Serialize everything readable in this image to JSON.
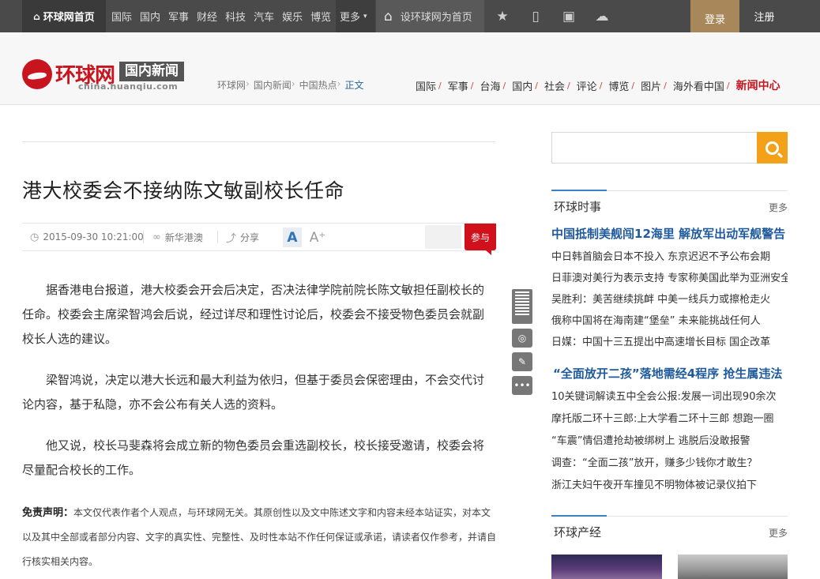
{
  "topbar": {
    "home": "环球网首页",
    "nav": [
      "国际",
      "国内",
      "军事",
      "财经",
      "科技",
      "汽车",
      "娱乐",
      "博览"
    ],
    "more": "更多",
    "set_home": "设环球网为首页",
    "login": "登录",
    "register": "注册"
  },
  "header": {
    "brand": "环球网",
    "channel": "国内新闻",
    "domain": "china.huanqiu.com",
    "breadcrumb": [
      "环球网",
      "国内新闻",
      "中国热点",
      "正文"
    ],
    "channel_nav": [
      "国际",
      "军事",
      "台海",
      "国内",
      "社会",
      "评论",
      "博览",
      "图片",
      "海外看中国"
    ],
    "channel_nav_highlight": "新闻中心"
  },
  "article": {
    "title": "港大校委会不接纳陈文敏副校长任命",
    "datetime": "2015-09-30 10:21:00",
    "source": "新华港澳",
    "share": "分享",
    "join": "参与",
    "paragraphs": [
      "据香港电台报道，港大校委会开会后决定，否决法律学院前院长陈文敏担任副校长的任命。校委会主席梁智鸿会后说，经过详尽和理性讨论后，校委会不接受物色委员会就副校长人选的建议。",
      "梁智鸿说，决定以港大长远和最大利益为依归，但基于委员会保密理由，不会交代讨论内容，基于私隐，亦不会公布有关人选的资料。",
      "他又说，校长马斐森将会成立新的物色委员会重选副校长，校长接受邀请，校委会将尽量配合校长的工作。"
    ],
    "disclaimer_label": "免责声明：",
    "disclaimer_text": "本文仅代表作者个人观点，与环球网无关。其原创性以及文中陈述文字和内容未经本站证实，对本文以及其中全部或者部分内容、文字的真实性、完整性、及时性本站不作任何保证或承诺，请读者仅作参考，并请自行核实相关内容。"
  },
  "sidebar": {
    "section1": {
      "title": "环球时事",
      "more": "更多",
      "lead": "中国抵制美舰闯12海里 解放军出动军舰警告",
      "items": [
        "中日韩首脑会日本不投入 东京迟迟不予公布会期",
        "日菲澳对美行为表示支持 专家称美国此举为亚洲安全",
        "吴胜利：美苦继续挑衅 中美一线兵力或擦枪走火",
        "俄称中国将在海南建“堡垒” 未来能挑战任何人",
        "日媒：中国十三五提出中高速增长目标 国企改革"
      ],
      "lead2": "“全面放开二孩”落地需经4程序 抢生属违法",
      "items2": [
        "10关键词解读五中全会公报:发展一词出现90余次",
        "摩托版二环十三郎:上大学看二环十三郎 想跑一圈",
        "“车震”情侣遭抢劫被绑树上 逃脱后没敢报警",
        "调查：“全面二孩”放开，赚多少钱你才敢生？",
        "浙江夫妇午夜开车撞见不明物体被记录仪拍下"
      ]
    },
    "section2": {
      "title": "环球产经",
      "more": "更多"
    }
  }
}
